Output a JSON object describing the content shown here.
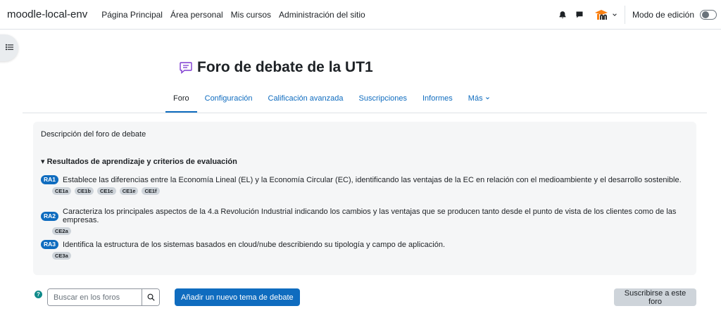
{
  "navbar": {
    "brand": "moodle-local-env",
    "links": [
      "Página Principal",
      "Área personal",
      "Mis cursos",
      "Administración del sitio"
    ],
    "edit_mode_label": "Modo de edición"
  },
  "page": {
    "title": "Foro de debate de la UT1"
  },
  "secondary_nav": {
    "items": [
      "Foro",
      "Configuración",
      "Calificación avanzada",
      "Suscripciones",
      "Informes",
      "Más"
    ]
  },
  "description": {
    "title": "Descripción del foro de debate",
    "results_heading": "▾ Resultados de aprendizaje y criterios de evaluación",
    "results": [
      {
        "badge": "RA1",
        "text": "Establece las diferencias entre la Economía Lineal (EL) y la Economía Circular (EC), identificando las ventajas de la EC en relación con el medioambiente y el desarrollo sostenible.",
        "criteria": [
          "CE1a",
          "CE1b",
          "CE1c",
          "CE1e",
          "CE1f"
        ]
      },
      {
        "badge": "RA2",
        "text": "Caracteriza los principales aspectos de la 4.a Revolución Industrial indicando los cambios y las ventajas que se producen tanto desde el punto de vista de los clientes como de las empresas.",
        "criteria": [
          "CE2a"
        ]
      },
      {
        "badge": "RA3",
        "text": "Identifica la estructura de los sistemas basados en cloud/nube describiendo su tipología y campo de aplicación.",
        "criteria": [
          "CE3a"
        ]
      }
    ]
  },
  "controls": {
    "search_placeholder": "Buscar en los foros",
    "add_button": "Añadir un nuevo tema de debate",
    "subscribe_button": "Suscribirse a este foro",
    "help_glyph": "?"
  },
  "colors": {
    "primary": "#0f6cbf",
    "badge_secondary": "#ced4da",
    "forum_icon": "#7e3bd0"
  }
}
